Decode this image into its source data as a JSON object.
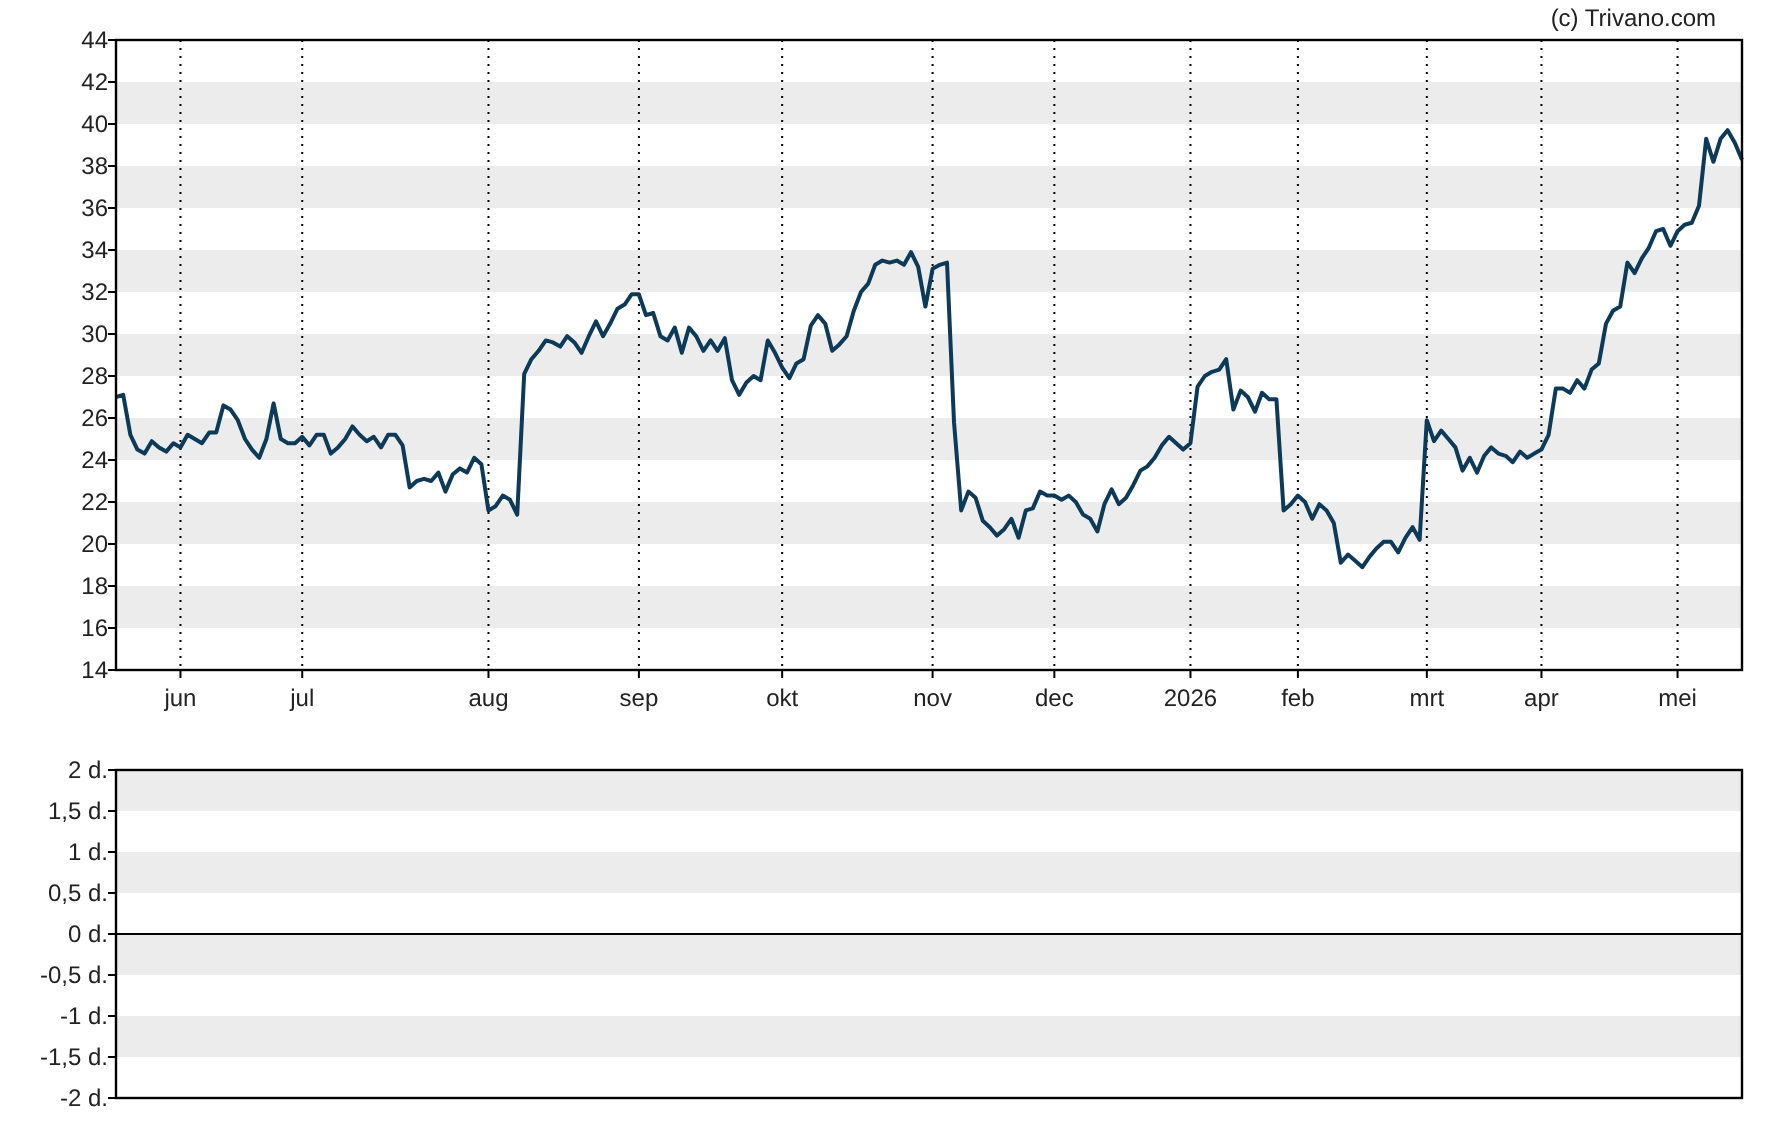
{
  "credit": "(c) Trivano.com",
  "price_chart": {
    "chart_data": {
      "type": "line",
      "ylim": [
        14,
        44
      ],
      "yticks": [
        14,
        16,
        18,
        20,
        22,
        24,
        26,
        28,
        30,
        32,
        34,
        36,
        38,
        40,
        42,
        44
      ],
      "categories": [
        null,
        null,
        null,
        null,
        null,
        null,
        null,
        null,
        null,
        "jun",
        null,
        null,
        null,
        null,
        null,
        null,
        null,
        null,
        null,
        null,
        null,
        null,
        null,
        null,
        null,
        null,
        "jul",
        null,
        null,
        null,
        null,
        null,
        null,
        null,
        null,
        null,
        null,
        null,
        null,
        null,
        null,
        null,
        null,
        null,
        null,
        null,
        null,
        null,
        null,
        null,
        null,
        null,
        "aug",
        null,
        null,
        null,
        null,
        null,
        null,
        null,
        null,
        null,
        null,
        null,
        null,
        null,
        null,
        null,
        null,
        null,
        null,
        null,
        null,
        "sep",
        null,
        null,
        null,
        null,
        null,
        null,
        null,
        null,
        null,
        null,
        null,
        null,
        null,
        null,
        null,
        null,
        null,
        null,
        null,
        "okt",
        null,
        null,
        null,
        null,
        null,
        null,
        null,
        null,
        null,
        null,
        null,
        null,
        null,
        null,
        null,
        null,
        null,
        null,
        null,
        null,
        "nov",
        null,
        null,
        null,
        null,
        null,
        null,
        null,
        null,
        null,
        null,
        null,
        null,
        null,
        null,
        null,
        null,
        "dec",
        null,
        null,
        null,
        null,
        null,
        null,
        null,
        null,
        null,
        null,
        null,
        null,
        null,
        null,
        null,
        null,
        null,
        null,
        "2026",
        null,
        null,
        null,
        null,
        null,
        null,
        null,
        null,
        null,
        null,
        null,
        null,
        null,
        null,
        "feb",
        null,
        null,
        null,
        null,
        null,
        null,
        null,
        null,
        null,
        null,
        null,
        null,
        null,
        null,
        null,
        null,
        null,
        "mrt",
        null,
        null,
        null,
        null,
        null,
        null,
        null,
        null,
        null,
        null,
        null,
        null,
        null,
        null,
        null,
        "apr",
        null,
        null,
        null,
        null,
        null,
        null,
        null,
        null,
        null,
        null,
        null,
        null,
        null,
        null,
        null,
        null,
        null,
        null,
        "mei",
        null,
        null,
        null,
        null,
        null,
        null,
        null,
        null,
        null
      ],
      "series": [
        {
          "color": "#0d3a58",
          "values": [
            27,
            27.1,
            25.2,
            24.5,
            24.3,
            24.9,
            24.6,
            24.4,
            24.8,
            24.6,
            25.2,
            25,
            24.8,
            25.3,
            25.3,
            26.6,
            26.4,
            25.9,
            25,
            24.5,
            24.1,
            25,
            26.7,
            25,
            24.8,
            24.8,
            25.1,
            24.7,
            25.2,
            25.2,
            24.3,
            24.6,
            25,
            25.6,
            25.2,
            24.9,
            25.1,
            24.6,
            25.2,
            25.2,
            24.7,
            22.7,
            23,
            23.1,
            23,
            23.4,
            22.5,
            23.3,
            23.6,
            23.4,
            24.1,
            23.8,
            21.6,
            21.8,
            22.3,
            22.1,
            21.4,
            28.1,
            28.8,
            29.2,
            29.7,
            29.6,
            29.4,
            29.9,
            29.6,
            29.1,
            29.9,
            30.6,
            29.9,
            30.5,
            31.2,
            31.4,
            31.9,
            31.9,
            30.9,
            31,
            29.9,
            29.7,
            30.3,
            29.1,
            30.3,
            29.9,
            29.2,
            29.7,
            29.2,
            29.8,
            27.8,
            27.1,
            27.7,
            28,
            27.8,
            29.7,
            29.1,
            28.4,
            27.9,
            28.6,
            28.8,
            30.4,
            30.9,
            30.5,
            29.2,
            29.5,
            29.9,
            31.1,
            32,
            32.4,
            33.3,
            33.5,
            33.4,
            33.5,
            33.3,
            33.9,
            33.2,
            31.3,
            33.1,
            33.3,
            33.4,
            25.8,
            21.6,
            22.5,
            22.2,
            21.1,
            20.8,
            20.4,
            20.7,
            21.2,
            20.3,
            21.6,
            21.7,
            22.5,
            22.3,
            22.3,
            22.1,
            22.3,
            22,
            21.4,
            21.2,
            20.6,
            21.9,
            22.6,
            21.9,
            22.2,
            22.8,
            23.5,
            23.7,
            24.1,
            24.7,
            25.1,
            24.8,
            24.5,
            24.8,
            27.5,
            28,
            28.2,
            28.3,
            28.8,
            26.4,
            27.3,
            27,
            26.3,
            27.2,
            26.9,
            26.9,
            21.6,
            21.9,
            22.3,
            22,
            21.2,
            21.9,
            21.6,
            21,
            19.1,
            19.5,
            19.2,
            18.9,
            19.4,
            19.8,
            20.1,
            20.1,
            19.6,
            20.3,
            20.8,
            20.2,
            25.9,
            24.9,
            25.4,
            25,
            24.6,
            23.5,
            24.1,
            23.4,
            24.2,
            24.6,
            24.3,
            24.2,
            23.9,
            24.4,
            24.1,
            24.3,
            24.5,
            25.2,
            27.4,
            27.4,
            27.2,
            27.8,
            27.4,
            28.3,
            28.6,
            30.5,
            31.1,
            31.3,
            33.4,
            32.9,
            33.6,
            34.1,
            34.9,
            35,
            34.2,
            34.9,
            35.2,
            35.3,
            36.1,
            39.3,
            38.2,
            39.3,
            39.7,
            39.1,
            38.3
          ]
        }
      ]
    }
  },
  "lower_chart": {
    "chart_data": {
      "type": "line",
      "categories": [
        null
      ],
      "ylim": [
        -2,
        2
      ],
      "yticks": [
        {
          "value": -2,
          "label": "-2 d."
        },
        {
          "value": -1.5,
          "label": "-1,5 d."
        },
        {
          "value": -1,
          "label": "-1 d."
        },
        {
          "value": -0.5,
          "label": "-0,5 d."
        },
        {
          "value": 0,
          "label": "0 d."
        },
        {
          "value": 0.5,
          "label": "0,5 d."
        },
        {
          "value": 1,
          "label": "1 d."
        },
        {
          "value": 1.5,
          "label": "1,5 d."
        },
        {
          "value": 2,
          "label": "2 d."
        }
      ]
    }
  }
}
